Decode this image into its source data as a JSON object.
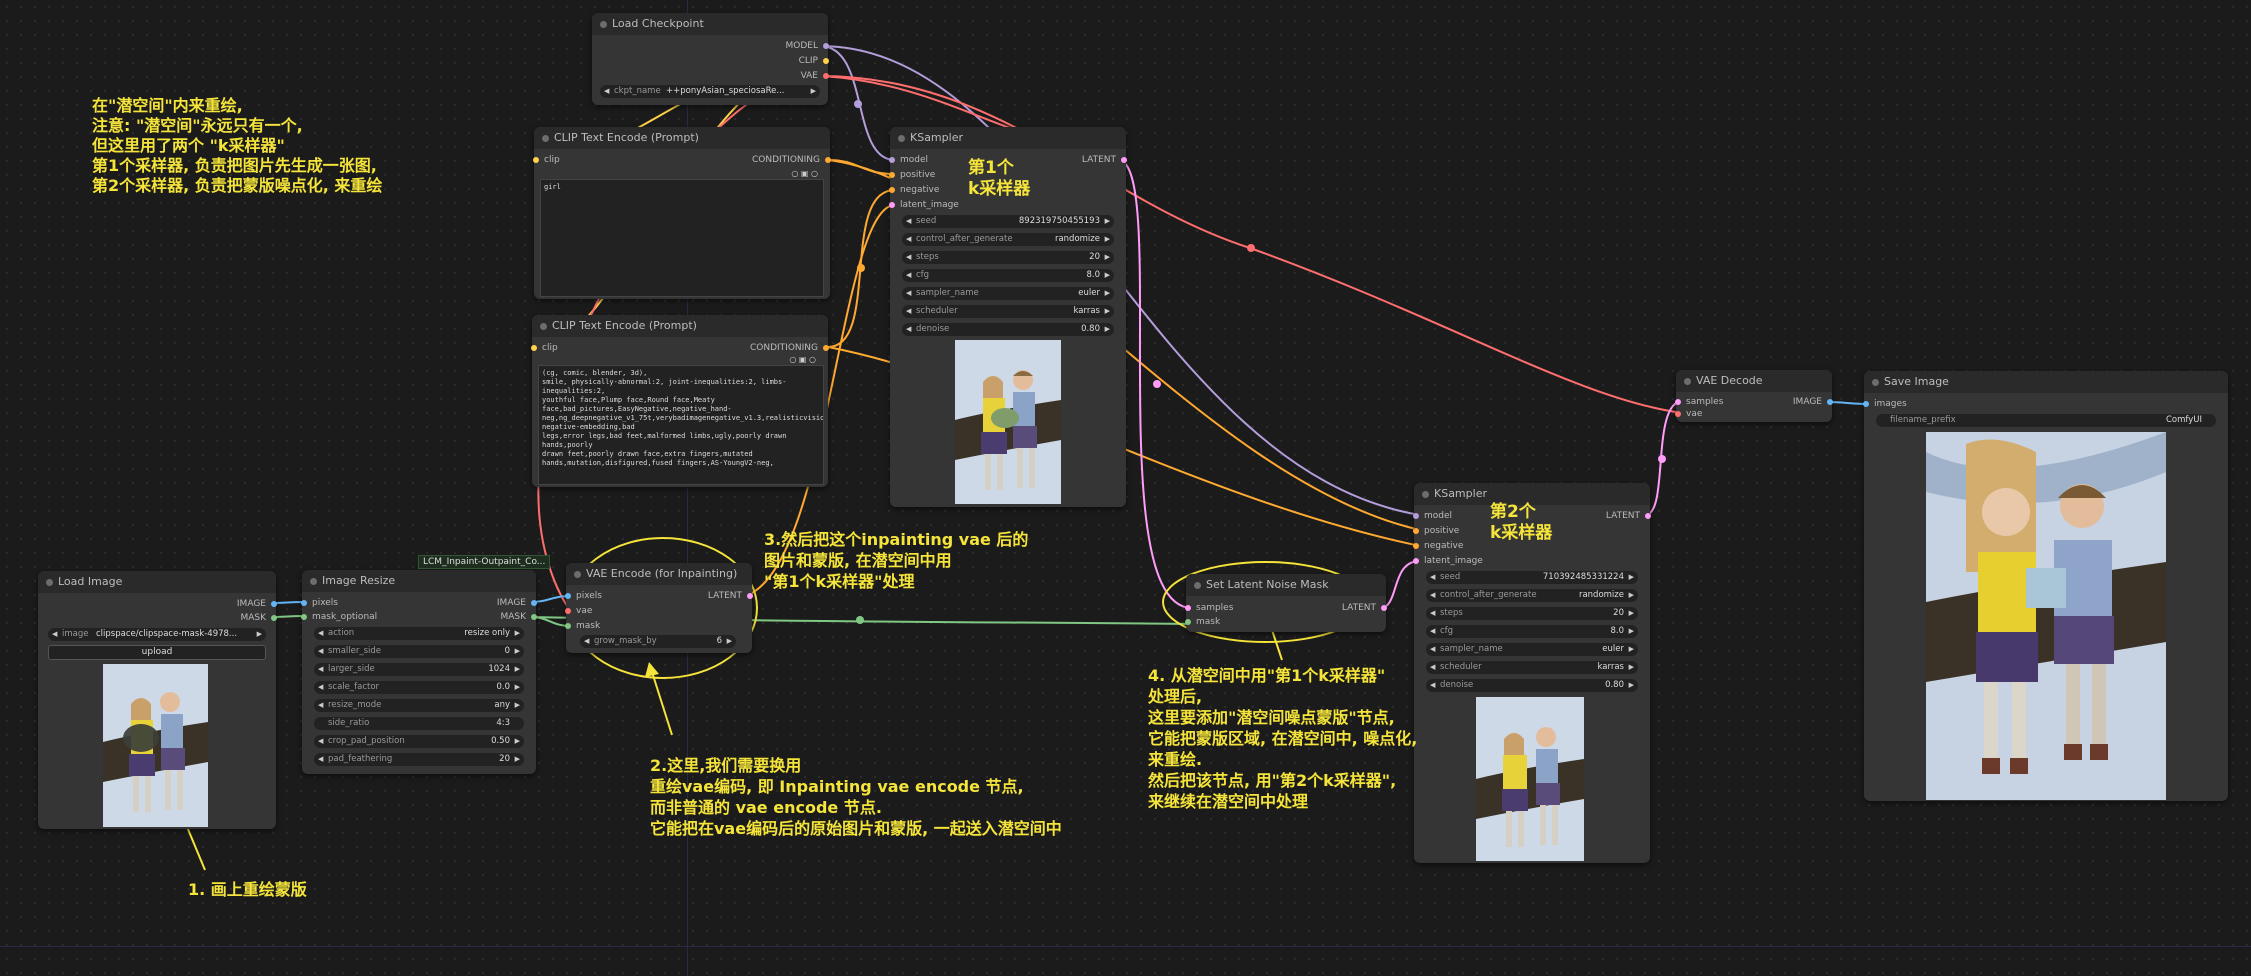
{
  "colors": {
    "accent_annotation": "#f5e43a",
    "model": "#b39ddb",
    "clip": "#ffd24a",
    "vae": "#ff6e6e",
    "conditioning": "#ffa931",
    "latent": "#ff9cf9",
    "image": "#64b5f6",
    "mask": "#81c784",
    "int": "#29b6f6"
  },
  "nodes": {
    "load_checkpoint": {
      "title": "Load Checkpoint",
      "outputs": [
        "MODEL",
        "CLIP",
        "VAE"
      ],
      "ckpt_label": "ckpt_name",
      "ckpt_value": "++ponyAsian_speciosaRe..."
    },
    "clip_text_pos": {
      "title": "CLIP Text Encode (Prompt)",
      "input": "clip",
      "output": "CONDITIONING",
      "text": "girl"
    },
    "clip_text_neg": {
      "title": "CLIP Text Encode (Prompt)",
      "input": "clip",
      "output": "CONDITIONING",
      "text": "(cg, comic, blender, 3d),\nsmile, physically-abnormal:2, joint-inequalities:2, limbs-inequalities:2,\nyouthful face,Plump face,Round face,Meaty\nface,bad_pictures,EasyNegative,negative_hand-\nneg,ng_deepnegative_v1_75t,verybadimagenegative_v1.3,realisticvision-negative-embedding,bad\nlegs,error legs,bad feet,malformed limbs,ugly,poorly drawn hands,poorly\ndrawn feet,poorly drawn face,extra fingers,mutated\nhands,mutation,disfigured,fused fingers,AS-YoungV2-neg,"
    },
    "ksampler1": {
      "title": "KSampler",
      "inputs": [
        "model",
        "positive",
        "negative",
        "latent_image"
      ],
      "output": "LATENT",
      "widgets": [
        {
          "label": "seed",
          "value": "892319750455193"
        },
        {
          "label": "control_after_generate",
          "value": "randomize"
        },
        {
          "label": "steps",
          "value": "20"
        },
        {
          "label": "cfg",
          "value": "8.0"
        },
        {
          "label": "sampler_name",
          "value": "euler"
        },
        {
          "label": "scheduler",
          "value": "karras"
        },
        {
          "label": "denoise",
          "value": "0.80"
        }
      ]
    },
    "load_image": {
      "title": "Load Image",
      "outputs": [
        "IMAGE",
        "MASK"
      ],
      "image_label": "image",
      "image_value": "clipspace/clipspace-mask-4978...",
      "upload_label": "upload"
    },
    "image_resize": {
      "title": "Image Resize",
      "inputs": [
        "pixels",
        "mask_optional"
      ],
      "outputs": [
        "IMAGE",
        "MASK"
      ],
      "widgets": [
        {
          "label": "action",
          "value": "resize only"
        },
        {
          "label": "smaller_side",
          "value": "0"
        },
        {
          "label": "larger_side",
          "value": "1024"
        },
        {
          "label": "scale_factor",
          "value": "0.0"
        },
        {
          "label": "resize_mode",
          "value": "any"
        },
        {
          "label": "side_ratio",
          "value": "4:3"
        },
        {
          "label": "crop_pad_position",
          "value": "0.50"
        },
        {
          "label": "pad_feathering",
          "value": "20"
        }
      ]
    },
    "group_tag": {
      "label": "LCM_Inpaint-Outpaint_Co..."
    },
    "vae_encode_inpaint": {
      "title": "VAE Encode (for Inpainting)",
      "inputs": [
        "pixels",
        "vae",
        "mask"
      ],
      "output": "LATENT",
      "widgets": [
        {
          "label": "grow_mask_by",
          "value": "6"
        }
      ]
    },
    "set_latent_noise_mask": {
      "title": "Set Latent Noise Mask",
      "inputs": [
        "samples",
        "mask"
      ],
      "output": "LATENT"
    },
    "ksampler2": {
      "title": "KSampler",
      "inputs": [
        "model",
        "positive",
        "negative",
        "latent_image"
      ],
      "output": "LATENT",
      "widgets": [
        {
          "label": "seed",
          "value": "710392485331224"
        },
        {
          "label": "control_after_generate",
          "value": "randomize"
        },
        {
          "label": "steps",
          "value": "20"
        },
        {
          "label": "cfg",
          "value": "8.0"
        },
        {
          "label": "sampler_name",
          "value": "euler"
        },
        {
          "label": "scheduler",
          "value": "karras"
        },
        {
          "label": "denoise",
          "value": "0.80"
        }
      ]
    },
    "vae_decode": {
      "title": "VAE Decode",
      "inputs": [
        "samples",
        "vae"
      ],
      "output": "IMAGE"
    },
    "save_image": {
      "title": "Save Image",
      "input": "images",
      "prefix_label": "filename_prefix",
      "prefix_value": "ComfyUI"
    }
  },
  "annotations": {
    "intro": [
      "在\"潜空间\"内来重绘,",
      "注意: \"潜空间\"永远只有一个,",
      "但这里用了两个 \"k采样器\"",
      "第1个采样器, 负责把图片先生成一张图,",
      "第2个采样器, 负责把蒙版噪点化, 来重绘"
    ],
    "k1_label": [
      "第1个",
      "k采样器"
    ],
    "k2_label": [
      "第2个",
      "k采样器"
    ],
    "step1": "1. 画上重绘蒙版",
    "step2": [
      "2.这里,我们需要换用",
      "重绘vae编码, 即 Inpainting vae encode 节点,",
      "而非普通的 vae encode 节点.",
      "它能把在vae编码后的原始图片和蒙版, 一起送入潜空间中"
    ],
    "step3": [
      "3.然后把这个inpainting vae 后的",
      "图片和蒙版, 在潜空间中用",
      "\"第1个k采样器\"处理"
    ],
    "step4": [
      "4.  从潜空间中用\"第1个k采样器\"",
      "处理后,",
      "这里要添加\"潜空间噪点蒙版\"节点,",
      "它能把蒙版区域, 在潜空间中, 噪点化,",
      "来重绘.",
      "然后把该节点, 用\"第2个k采样器\",",
      "来继续在潜空间中处理"
    ]
  }
}
